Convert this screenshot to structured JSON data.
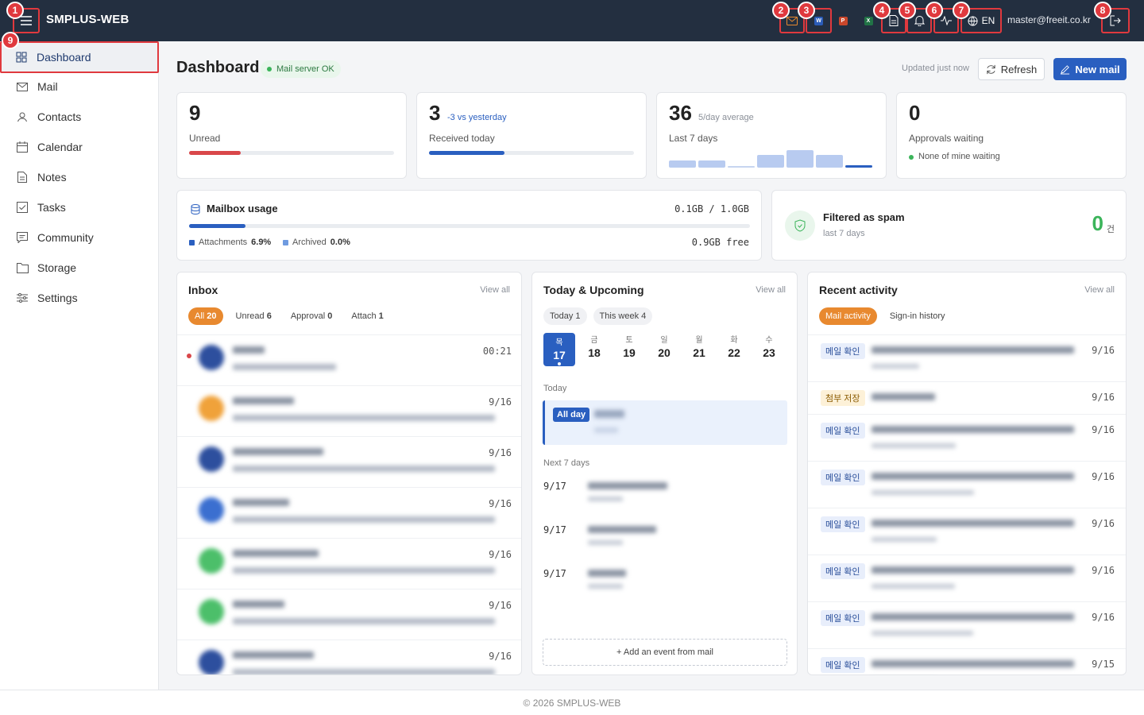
{
  "topbar": {
    "brand": "SMPLUS-WEB",
    "lang": "EN",
    "user_email": "master@freeit.co.kr",
    "badges": [
      "1",
      "2",
      "3",
      "4",
      "5",
      "6",
      "7",
      "8",
      "9"
    ],
    "app_letters": {
      "word": "W",
      "ppt": "P",
      "excel": "X"
    }
  },
  "sidebar": {
    "items": [
      {
        "label": "Dashboard",
        "icon": "grid-icon",
        "active": true
      },
      {
        "label": "Mail",
        "icon": "mail-icon"
      },
      {
        "label": "Contacts",
        "icon": "contacts-icon"
      },
      {
        "label": "Calendar",
        "icon": "calendar-icon"
      },
      {
        "label": "Notes",
        "icon": "notes-icon"
      },
      {
        "label": "Tasks",
        "icon": "tasks-icon"
      },
      {
        "label": "Community",
        "icon": "community-icon"
      },
      {
        "label": "Storage",
        "icon": "folder-icon"
      },
      {
        "label": "Settings",
        "icon": "sliders-icon"
      }
    ]
  },
  "header": {
    "title": "Dashboard",
    "server_status": "Mail server OK",
    "updated": "Updated just now",
    "refresh_label": "Refresh",
    "new_mail_label": "New mail"
  },
  "stats": {
    "unread": {
      "value": "9",
      "label": "Unread",
      "progress": 0.25,
      "color": "#d9474a"
    },
    "received": {
      "value": "3",
      "delta": "-3 vs yesterday",
      "label": "Received today",
      "progress": 0.37,
      "color": "#2a5fc0"
    },
    "week": {
      "value": "36",
      "avg": "5/day average",
      "label": "Last 7 days",
      "bars": [
        3,
        3,
        0,
        5,
        7,
        5,
        1
      ]
    },
    "approvals": {
      "value": "0",
      "label": "Approvals waiting",
      "note": "None of mine waiting"
    }
  },
  "mailbox": {
    "title": "Mailbox usage",
    "usage": "0.1GB / 1.0GB",
    "progress": 0.1,
    "attachments_label": "Attachments",
    "attachments_value": "6.9%",
    "archived_label": "Archived",
    "archived_value": "0.0%",
    "free": "0.9GB free"
  },
  "spam": {
    "title": "Filtered as spam",
    "subtitle": "last 7 days",
    "count": "0",
    "unit": "건"
  },
  "inbox": {
    "title": "Inbox",
    "view_all": "View all",
    "filters": [
      {
        "label": "All",
        "count": "20",
        "active": true
      },
      {
        "label": "Unread",
        "count": "6"
      },
      {
        "label": "Approval",
        "count": "0"
      },
      {
        "label": "Attach",
        "count": "1"
      }
    ],
    "rows": [
      {
        "time": "00:21",
        "avatar": "#2d4f9e",
        "unread": true
      },
      {
        "time": "9/16",
        "avatar": "#f0a23a"
      },
      {
        "time": "9/16",
        "avatar": "#2d4f9e"
      },
      {
        "time": "9/16",
        "avatar": "#3b6fd0"
      },
      {
        "time": "9/16",
        "avatar": "#4cbf6a"
      },
      {
        "time": "9/16",
        "avatar": "#4cbf6a"
      },
      {
        "time": "9/16",
        "avatar": "#2d4f9e"
      }
    ]
  },
  "calendar": {
    "title": "Today & Upcoming",
    "view_all": "View all",
    "tabs": [
      {
        "label": "Today",
        "count": "1"
      },
      {
        "label": "This week",
        "count": "4"
      }
    ],
    "days": [
      {
        "name": "목",
        "date": "17",
        "selected": true
      },
      {
        "name": "금",
        "date": "18"
      },
      {
        "name": "토",
        "date": "19"
      },
      {
        "name": "일",
        "date": "20"
      },
      {
        "name": "월",
        "date": "21"
      },
      {
        "name": "화",
        "date": "22"
      },
      {
        "name": "수",
        "date": "23"
      }
    ],
    "today_label": "Today",
    "allday_label": "All day",
    "next_label": "Next 7 days",
    "upcoming": [
      "9/17",
      "9/17",
      "9/17"
    ],
    "add_event": "+ Add an event from mail"
  },
  "activity": {
    "title": "Recent activity",
    "view_all": "View all",
    "tabs": [
      {
        "label": "Mail activity",
        "active": true
      },
      {
        "label": "Sign-in history"
      }
    ],
    "rows": [
      {
        "tag": "메일 확인",
        "date": "9/16",
        "type": "info"
      },
      {
        "tag": "첨부 저장",
        "date": "9/16",
        "type": "warn"
      },
      {
        "tag": "메일 확인",
        "date": "9/16",
        "type": "info"
      },
      {
        "tag": "메일 확인",
        "date": "9/16",
        "type": "info"
      },
      {
        "tag": "메일 확인",
        "date": "9/16",
        "type": "info"
      },
      {
        "tag": "메일 확인",
        "date": "9/16",
        "type": "info"
      },
      {
        "tag": "메일 확인",
        "date": "9/16",
        "type": "info"
      },
      {
        "tag": "메일 확인",
        "date": "9/15",
        "type": "info"
      }
    ]
  },
  "footer": "© 2026 SMPLUS-WEB"
}
